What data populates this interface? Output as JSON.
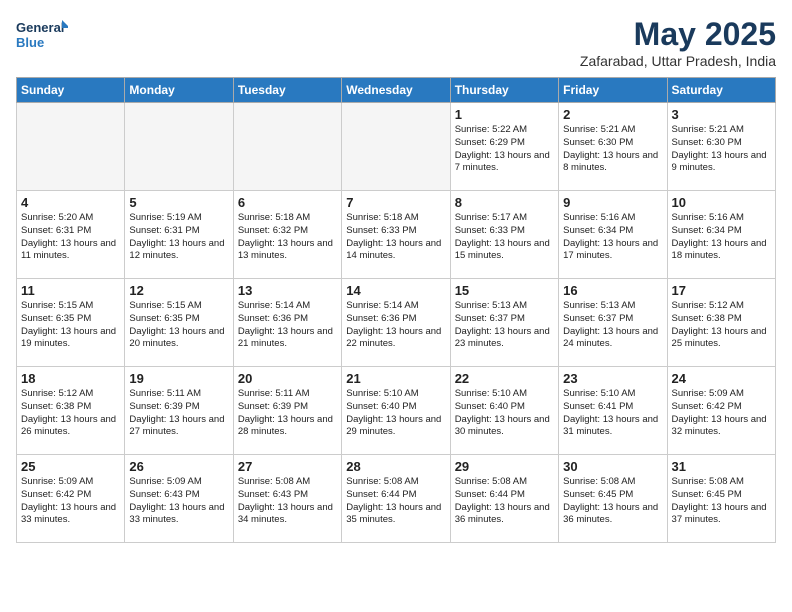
{
  "header": {
    "logo_line1": "General",
    "logo_line2": "Blue",
    "month_title": "May 2025",
    "subtitle": "Zafarabad, Uttar Pradesh, India"
  },
  "days_of_week": [
    "Sunday",
    "Monday",
    "Tuesday",
    "Wednesday",
    "Thursday",
    "Friday",
    "Saturday"
  ],
  "weeks": [
    [
      {
        "day": "",
        "empty": true
      },
      {
        "day": "",
        "empty": true
      },
      {
        "day": "",
        "empty": true
      },
      {
        "day": "",
        "empty": true
      },
      {
        "day": "1",
        "sunrise": "5:22 AM",
        "sunset": "6:29 PM",
        "daylight": "13 hours and 7 minutes."
      },
      {
        "day": "2",
        "sunrise": "5:21 AM",
        "sunset": "6:30 PM",
        "daylight": "13 hours and 8 minutes."
      },
      {
        "day": "3",
        "sunrise": "5:21 AM",
        "sunset": "6:30 PM",
        "daylight": "13 hours and 9 minutes."
      }
    ],
    [
      {
        "day": "4",
        "sunrise": "5:20 AM",
        "sunset": "6:31 PM",
        "daylight": "13 hours and 11 minutes."
      },
      {
        "day": "5",
        "sunrise": "5:19 AM",
        "sunset": "6:31 PM",
        "daylight": "13 hours and 12 minutes."
      },
      {
        "day": "6",
        "sunrise": "5:18 AM",
        "sunset": "6:32 PM",
        "daylight": "13 hours and 13 minutes."
      },
      {
        "day": "7",
        "sunrise": "5:18 AM",
        "sunset": "6:33 PM",
        "daylight": "13 hours and 14 minutes."
      },
      {
        "day": "8",
        "sunrise": "5:17 AM",
        "sunset": "6:33 PM",
        "daylight": "13 hours and 15 minutes."
      },
      {
        "day": "9",
        "sunrise": "5:16 AM",
        "sunset": "6:34 PM",
        "daylight": "13 hours and 17 minutes."
      },
      {
        "day": "10",
        "sunrise": "5:16 AM",
        "sunset": "6:34 PM",
        "daylight": "13 hours and 18 minutes."
      }
    ],
    [
      {
        "day": "11",
        "sunrise": "5:15 AM",
        "sunset": "6:35 PM",
        "daylight": "13 hours and 19 minutes."
      },
      {
        "day": "12",
        "sunrise": "5:15 AM",
        "sunset": "6:35 PM",
        "daylight": "13 hours and 20 minutes."
      },
      {
        "day": "13",
        "sunrise": "5:14 AM",
        "sunset": "6:36 PM",
        "daylight": "13 hours and 21 minutes."
      },
      {
        "day": "14",
        "sunrise": "5:14 AM",
        "sunset": "6:36 PM",
        "daylight": "13 hours and 22 minutes."
      },
      {
        "day": "15",
        "sunrise": "5:13 AM",
        "sunset": "6:37 PM",
        "daylight": "13 hours and 23 minutes."
      },
      {
        "day": "16",
        "sunrise": "5:13 AM",
        "sunset": "6:37 PM",
        "daylight": "13 hours and 24 minutes."
      },
      {
        "day": "17",
        "sunrise": "5:12 AM",
        "sunset": "6:38 PM",
        "daylight": "13 hours and 25 minutes."
      }
    ],
    [
      {
        "day": "18",
        "sunrise": "5:12 AM",
        "sunset": "6:38 PM",
        "daylight": "13 hours and 26 minutes."
      },
      {
        "day": "19",
        "sunrise": "5:11 AM",
        "sunset": "6:39 PM",
        "daylight": "13 hours and 27 minutes."
      },
      {
        "day": "20",
        "sunrise": "5:11 AM",
        "sunset": "6:39 PM",
        "daylight": "13 hours and 28 minutes."
      },
      {
        "day": "21",
        "sunrise": "5:10 AM",
        "sunset": "6:40 PM",
        "daylight": "13 hours and 29 minutes."
      },
      {
        "day": "22",
        "sunrise": "5:10 AM",
        "sunset": "6:40 PM",
        "daylight": "13 hours and 30 minutes."
      },
      {
        "day": "23",
        "sunrise": "5:10 AM",
        "sunset": "6:41 PM",
        "daylight": "13 hours and 31 minutes."
      },
      {
        "day": "24",
        "sunrise": "5:09 AM",
        "sunset": "6:42 PM",
        "daylight": "13 hours and 32 minutes."
      }
    ],
    [
      {
        "day": "25",
        "sunrise": "5:09 AM",
        "sunset": "6:42 PM",
        "daylight": "13 hours and 33 minutes."
      },
      {
        "day": "26",
        "sunrise": "5:09 AM",
        "sunset": "6:43 PM",
        "daylight": "13 hours and 33 minutes."
      },
      {
        "day": "27",
        "sunrise": "5:08 AM",
        "sunset": "6:43 PM",
        "daylight": "13 hours and 34 minutes."
      },
      {
        "day": "28",
        "sunrise": "5:08 AM",
        "sunset": "6:44 PM",
        "daylight": "13 hours and 35 minutes."
      },
      {
        "day": "29",
        "sunrise": "5:08 AM",
        "sunset": "6:44 PM",
        "daylight": "13 hours and 36 minutes."
      },
      {
        "day": "30",
        "sunrise": "5:08 AM",
        "sunset": "6:45 PM",
        "daylight": "13 hours and 36 minutes."
      },
      {
        "day": "31",
        "sunrise": "5:08 AM",
        "sunset": "6:45 PM",
        "daylight": "13 hours and 37 minutes."
      }
    ]
  ]
}
